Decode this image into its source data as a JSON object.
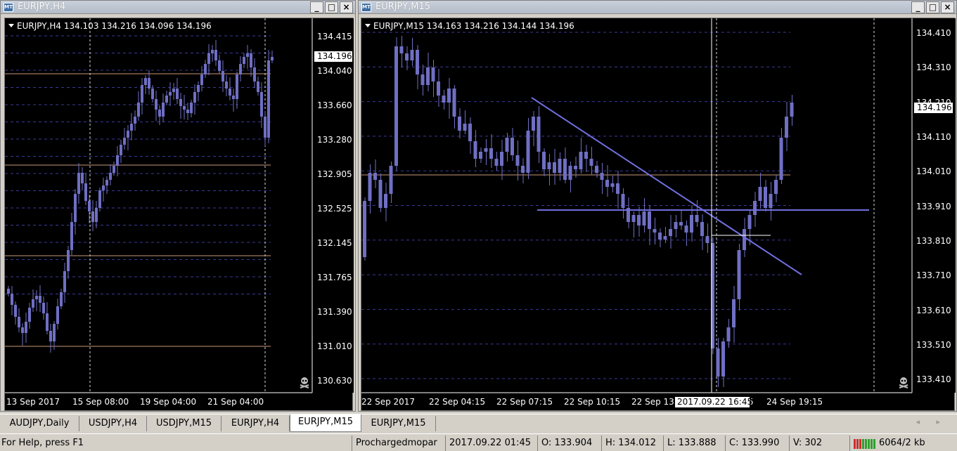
{
  "windows": [
    {
      "title": "EURJPY,H4",
      "info": "EURJPY,H4  134.103 134.216 134.096 134.196",
      "price_labels": [
        "134.415",
        "134.040",
        "133.660",
        "133.280",
        "132.905",
        "132.525",
        "132.145",
        "131.765",
        "131.390",
        "131.010",
        "130.630"
      ],
      "current_price": "134.196",
      "time_labels": [
        "13 Sep 2017",
        "15 Sep 08:00",
        "19 Sep 04:00",
        "21 Sep 04:00"
      ]
    },
    {
      "title": "EURJPY,M15",
      "info": "EURJPY,M15  134.163 134.216 134.144 134.196",
      "price_labels": [
        "134.410",
        "134.310",
        "134.210",
        "134.110",
        "134.010",
        "133.910",
        "133.810",
        "133.710",
        "133.610",
        "133.510",
        "133.410"
      ],
      "current_price": "134.196",
      "time_labels": [
        "22 Sep 2017",
        "22 Sep 04:15",
        "22 Sep 07:15",
        "22 Sep 10:15",
        "22 Sep 13",
        "5",
        "24 Sep 19:15"
      ],
      "crosshair_time": "2017.09.22 16:45"
    }
  ],
  "window_buttons": {
    "minimize": "_",
    "maximize": "□",
    "close": "×"
  },
  "tabs": [
    "AUDJPY,Daily",
    "USDJPY,H4",
    "USDJPY,M15",
    "EURJPY,H4",
    "EURJPY,M15",
    "EURJPY,M15"
  ],
  "active_tab": 4,
  "tab_arrows": "◂ ▸",
  "status": {
    "help": "For Help, press F1",
    "profile": "Prochargedmopar",
    "time": "2017.09.22 01:45",
    "open": "O: 133.904",
    "high": "H: 134.012",
    "low": "L: 133.888",
    "close": "C: 133.990",
    "volume": "V: 302",
    "traffic": "6064/2 kb"
  },
  "colors": {
    "chart_bg": "#000000",
    "candle": "#6f6fc4",
    "grid": "#3a3a9a",
    "level_line": "#c89878",
    "trendline": "#7070e0"
  },
  "icons": {
    "window": "chart-window-icon",
    "skull": "skull-icon",
    "dropdown": "triangle-down-icon"
  }
}
